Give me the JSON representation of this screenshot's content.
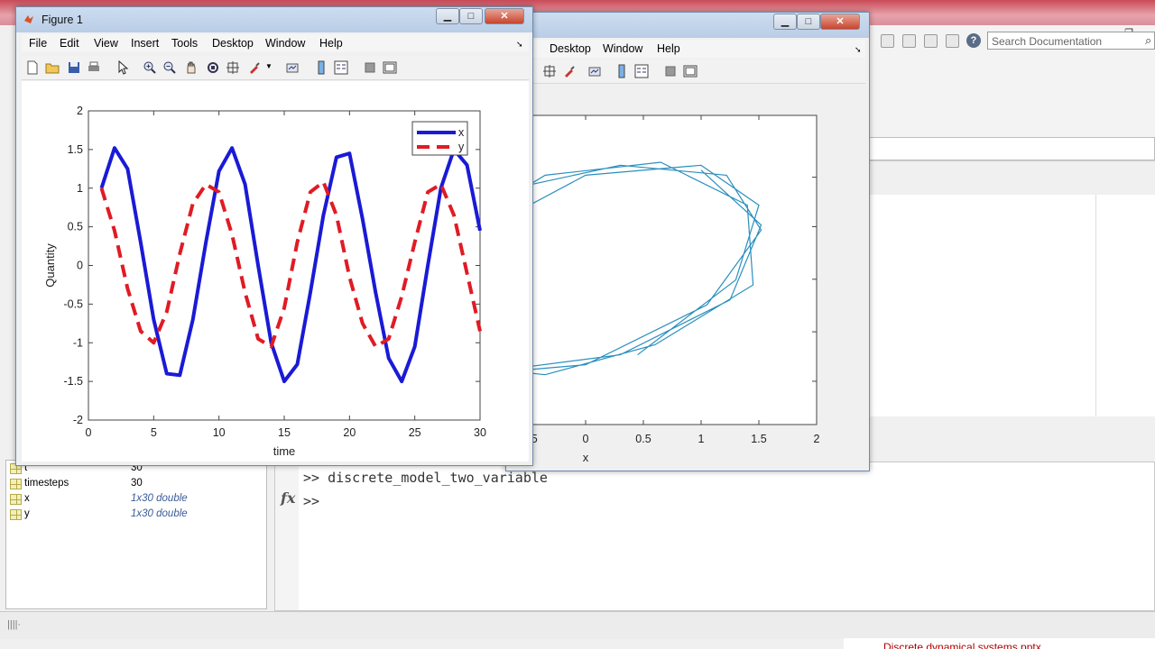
{
  "colors": {
    "x_series": "#1a1ad6",
    "y_series": "#e01b24",
    "ellipse": "#2a8fbd",
    "title_bar": "#c3d5ec"
  },
  "docs": {
    "search_placeholder": "Search Documentation"
  },
  "workspace": {
    "rows": [
      {
        "name": "t",
        "value": "30",
        "italic": false
      },
      {
        "name": "timesteps",
        "value": "30",
        "italic": false
      },
      {
        "name": "x",
        "value": "1x30 double",
        "italic": true
      },
      {
        "name": "y",
        "value": "1x30 double",
        "italic": true
      }
    ]
  },
  "command_window": {
    "line1": ">> discrete_model_two_variable",
    "prompt": ">>",
    "fx": "fx"
  },
  "taskbar": {
    "hint": "Discrete dynamical systems.pptx"
  },
  "figure1": {
    "title": "Figure 1",
    "menus": [
      "File",
      "Edit",
      "View",
      "Insert",
      "Tools",
      "Desktop",
      "Window",
      "Help"
    ],
    "icons": [
      "new-figure-icon",
      "open-icon",
      "save-icon",
      "print-icon",
      "pointer-icon",
      "zoom-in-icon",
      "zoom-out-icon",
      "pan-icon",
      "rotate-icon",
      "data-cursor-icon",
      "brush-icon",
      "link-icon",
      "colorbar-icon",
      "legend-icon",
      "hide-tools-icon",
      "show-tools-icon"
    ]
  },
  "figure2": {
    "menus": [
      "Desktop",
      "Window",
      "Help"
    ],
    "icons": [
      "data-cursor-icon",
      "brush-icon",
      "link-icon",
      "colorbar-icon",
      "legend-icon",
      "hide-tools-icon",
      "show-tools-icon"
    ]
  },
  "chart_data": [
    {
      "type": "line",
      "title": "",
      "xlabel": "time",
      "ylabel": "Quantity",
      "xlim": [
        0,
        30
      ],
      "ylim": [
        -2,
        2
      ],
      "xticks": [
        0,
        5,
        10,
        15,
        20,
        25,
        30
      ],
      "yticks": [
        -2,
        -1.5,
        -1,
        -0.5,
        0,
        0.5,
        1,
        1.5,
        2
      ],
      "legend": {
        "placement": "top-right",
        "entries": [
          "x",
          "y"
        ]
      },
      "x": [
        1,
        2,
        3,
        4,
        5,
        6,
        7,
        8,
        9,
        10,
        11,
        12,
        13,
        14,
        15,
        16,
        17,
        18,
        19,
        20,
        21,
        22,
        23,
        24,
        25,
        26,
        27,
        28,
        29,
        30
      ],
      "series": [
        {
          "name": "x",
          "style": "solid",
          "values": [
            1.0,
            1.52,
            1.25,
            0.3,
            -0.7,
            -1.4,
            -1.42,
            -0.7,
            0.3,
            1.22,
            1.52,
            1.05,
            0.0,
            -1.0,
            -1.5,
            -1.28,
            -0.35,
            0.65,
            1.4,
            1.45,
            0.6,
            -0.35,
            -1.2,
            -1.5,
            -1.05,
            0.0,
            1.0,
            1.5,
            1.3,
            0.45
          ]
        },
        {
          "name": "y",
          "style": "dashed",
          "values": [
            1.0,
            0.45,
            -0.3,
            -0.85,
            -1.0,
            -0.6,
            0.15,
            0.8,
            1.05,
            0.95,
            0.4,
            -0.35,
            -0.95,
            -1.05,
            -0.55,
            0.3,
            0.95,
            1.08,
            0.65,
            -0.15,
            -0.75,
            -1.05,
            -0.95,
            -0.4,
            0.3,
            0.95,
            1.05,
            0.65,
            -0.1,
            -0.85
          ]
        }
      ]
    },
    {
      "type": "line",
      "title": "",
      "xlabel": "x",
      "ylabel": "",
      "xlim": [
        -1,
        2
      ],
      "xticks": [
        -0.5,
        0,
        0.5,
        1,
        1.5,
        2
      ],
      "series": [
        {
          "name": "",
          "style": "solid",
          "points": [
            [
              1.0,
              1.0
            ],
            [
              1.52,
              0.45
            ],
            [
              1.25,
              -0.3
            ],
            [
              0.3,
              -0.85
            ],
            [
              -0.7,
              -1.0
            ],
            [
              -1.4,
              -0.6
            ],
            [
              -1.42,
              0.15
            ],
            [
              -0.7,
              0.8
            ],
            [
              0.3,
              1.05
            ],
            [
              1.22,
              0.95
            ],
            [
              1.52,
              0.4
            ],
            [
              1.05,
              -0.35
            ],
            [
              0.0,
              -0.95
            ],
            [
              -1.0,
              -1.05
            ],
            [
              -1.5,
              -0.55
            ],
            [
              -1.28,
              0.3
            ],
            [
              -0.35,
              0.95
            ],
            [
              0.65,
              1.08
            ],
            [
              1.4,
              0.65
            ],
            [
              1.45,
              -0.15
            ],
            [
              0.6,
              -0.75
            ],
            [
              -0.35,
              -1.05
            ],
            [
              -1.2,
              -0.95
            ],
            [
              -1.5,
              -0.4
            ],
            [
              -1.05,
              0.3
            ],
            [
              0.0,
              0.95
            ],
            [
              1.0,
              1.05
            ],
            [
              1.5,
              0.65
            ],
            [
              1.3,
              -0.1
            ],
            [
              0.45,
              -0.85
            ]
          ]
        }
      ]
    }
  ]
}
